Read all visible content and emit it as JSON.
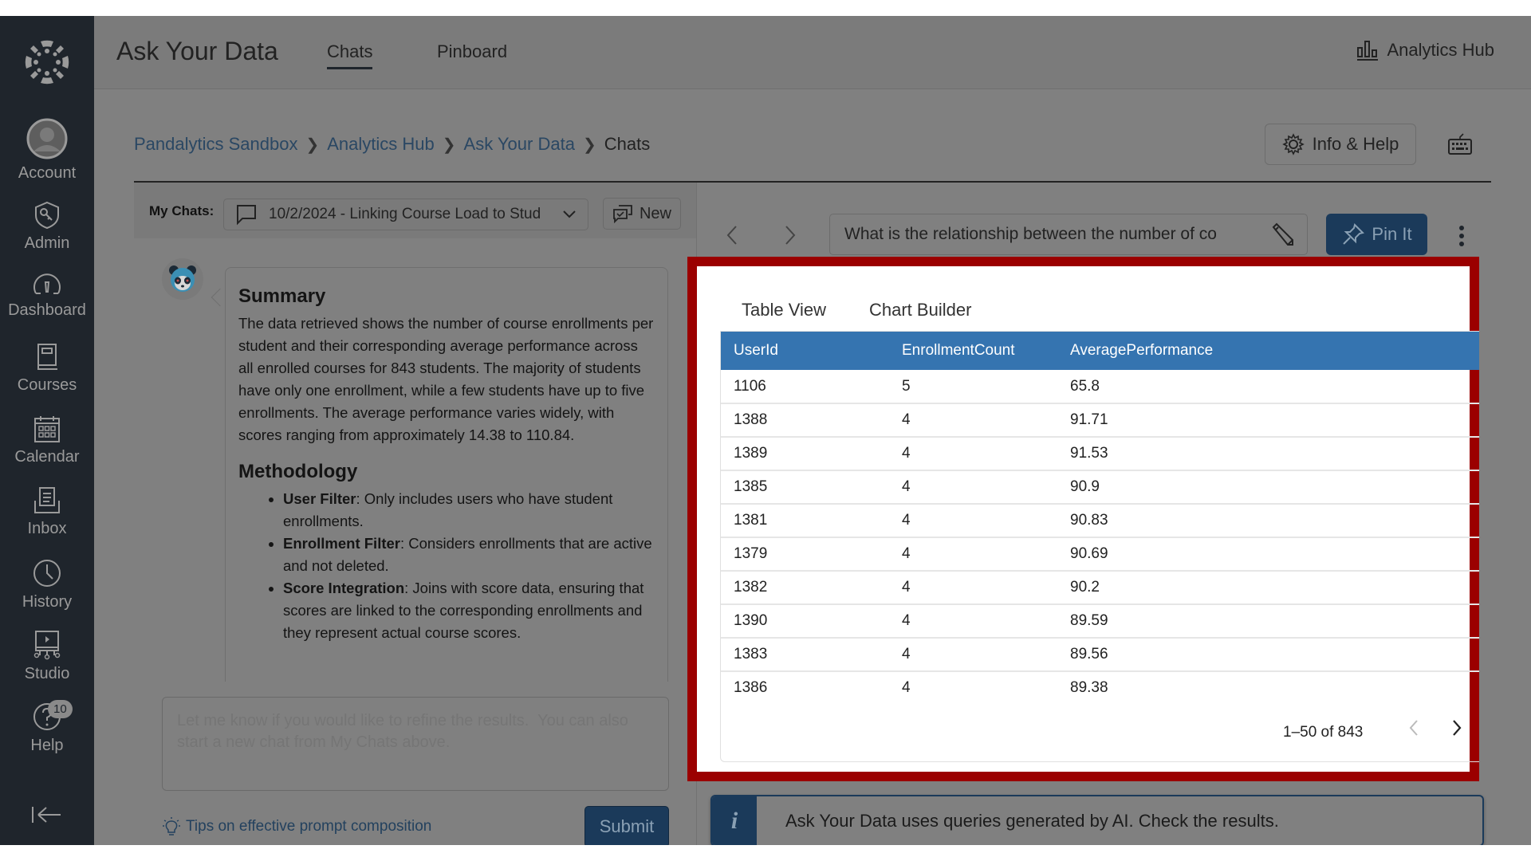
{
  "app": {
    "title": "Ask Your Data",
    "tabs": [
      {
        "label": "Chats",
        "active": true
      },
      {
        "label": "Pinboard",
        "active": false
      }
    ],
    "hub_link": "Analytics Hub",
    "hub_icon": "bar-chart-icon"
  },
  "sidebar": {
    "logo_icon": "canvas-logo-icon",
    "items": [
      {
        "label": "Account",
        "icon": "user-avatar-icon"
      },
      {
        "label": "Admin",
        "icon": "shield-key-icon"
      },
      {
        "label": "Dashboard",
        "icon": "speedometer-icon"
      },
      {
        "label": "Courses",
        "icon": "book-icon"
      },
      {
        "label": "Calendar",
        "icon": "calendar-icon"
      },
      {
        "label": "Inbox",
        "icon": "inbox-icon"
      },
      {
        "label": "History",
        "icon": "clock-icon"
      },
      {
        "label": "Studio",
        "icon": "studio-icon"
      },
      {
        "label": "Help",
        "icon": "help-icon",
        "badge": "10"
      }
    ],
    "collapse_icon": "collapse-arrow-icon"
  },
  "breadcrumb": {
    "items": [
      "Pandalytics Sandbox",
      "Analytics Hub",
      "Ask Your Data"
    ],
    "current": "Chats"
  },
  "header_actions": {
    "info_help": "Info & Help",
    "keyboard_icon": "keyboard-icon"
  },
  "my_chats": {
    "label": "My Chats:",
    "selected": "10/2/2024 - Linking Course Load to Stud",
    "new_label": "New"
  },
  "response": {
    "summary_title": "Summary",
    "summary_text": "The data retrieved shows the number of course enrollments per student and their corresponding average performance across all enrolled courses for 843 students. The majority of students have only one enrollment, while a few students have up to five enrollments. The average performance varies widely, with scores ranging from approximately 14.38 to 110.84.",
    "methodology_title": "Methodology",
    "methodology": [
      {
        "term": "User Filter",
        "text": ": Only includes users who have student enrollments."
      },
      {
        "term": "Enrollment Filter",
        "text": ": Considers enrollments that are active and not deleted."
      },
      {
        "term": "Score Integration",
        "text": ": Joins with score data, ensuring that scores are linked to the corresponding enrollments and they represent actual course scores."
      }
    ]
  },
  "prompt": {
    "placeholder": "Let me know if you would like to refine the results.  You can also start a new chat from My Chats above.",
    "tips_link": "Tips on effective prompt composition",
    "submit": "Submit"
  },
  "question": {
    "text": "What is the relationship between the number of co",
    "pin_label": "Pin It"
  },
  "results": {
    "tabs": [
      {
        "label": "Table View",
        "active": true
      },
      {
        "label": "Chart Builder",
        "active": false
      }
    ],
    "columns": [
      "UserId",
      "EnrollmentCount",
      "AveragePerformance"
    ],
    "rows": [
      [
        "1106",
        "5",
        "65.8"
      ],
      [
        "1388",
        "4",
        "91.71"
      ],
      [
        "1389",
        "4",
        "91.53"
      ],
      [
        "1385",
        "4",
        "90.9"
      ],
      [
        "1381",
        "4",
        "90.83"
      ],
      [
        "1379",
        "4",
        "90.69"
      ],
      [
        "1382",
        "4",
        "90.2"
      ],
      [
        "1390",
        "4",
        "89.59"
      ],
      [
        "1383",
        "4",
        "89.56"
      ],
      [
        "1386",
        "4",
        "89.38"
      ]
    ],
    "pagination": "1–50 of 843"
  },
  "banner": {
    "icon": "i",
    "text": "Ask Your Data uses queries generated by AI. Check the results."
  },
  "colors": {
    "highlight_border": "#9b0000",
    "table_header": "#3574b0",
    "primary_button": "#1b3a5a",
    "sidebar_bg": "#1f252c"
  }
}
